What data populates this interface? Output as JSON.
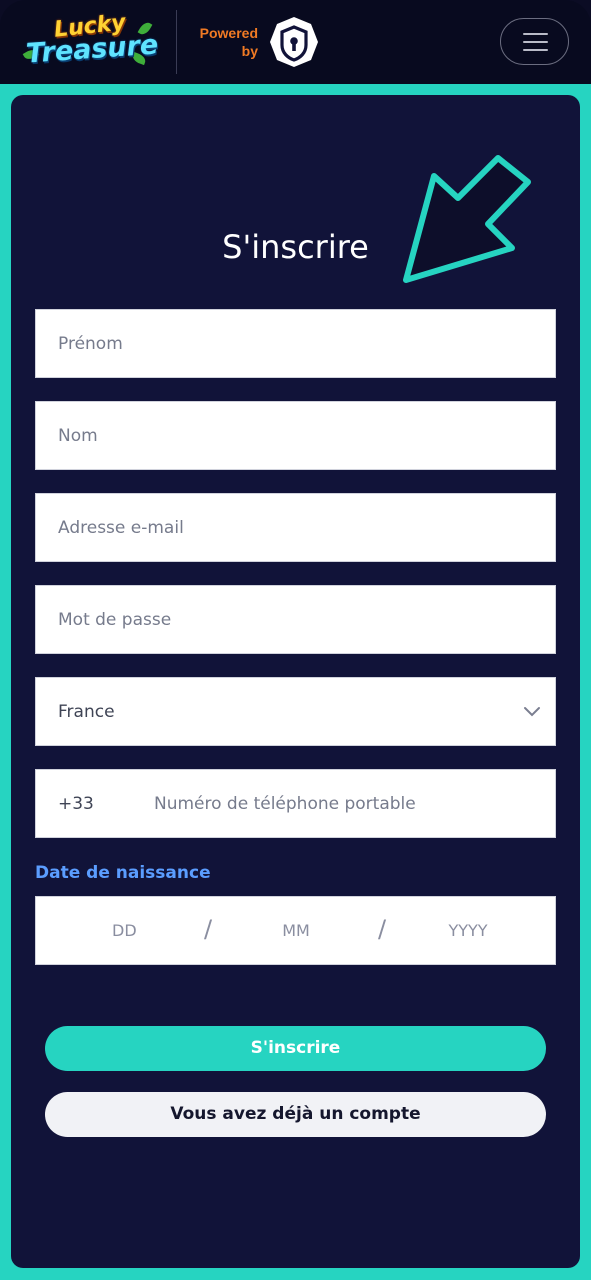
{
  "header": {
    "logo_text_1": "Lucky",
    "logo_text_2": "Treasure",
    "powered_by_line1": "Powered",
    "powered_by_line2": "by",
    "brand_icon": "shield-keyhole-icon",
    "menu_icon": "hamburger-menu-icon"
  },
  "form": {
    "title": "S'inscrire",
    "first_name_placeholder": "Prénom",
    "last_name_placeholder": "Nom",
    "email_placeholder": "Adresse e-mail",
    "password_placeholder": "Mot de passe",
    "country_value": "France",
    "phone_prefix": "+33",
    "phone_placeholder": "Numéro de téléphone portable",
    "dob_label": "Date de naissance",
    "dob_day": "DD",
    "dob_month": "MM",
    "dob_year": "YYYY",
    "dob_separator": "/",
    "submit_label": "S'inscrire",
    "login_label": "Vous avez déjà un compte"
  },
  "colors": {
    "accent": "#26d4c1",
    "background": "#111339",
    "header_bg": "#080a1f",
    "label_blue": "#5b9dff",
    "powered_orange": "#f07a24"
  }
}
